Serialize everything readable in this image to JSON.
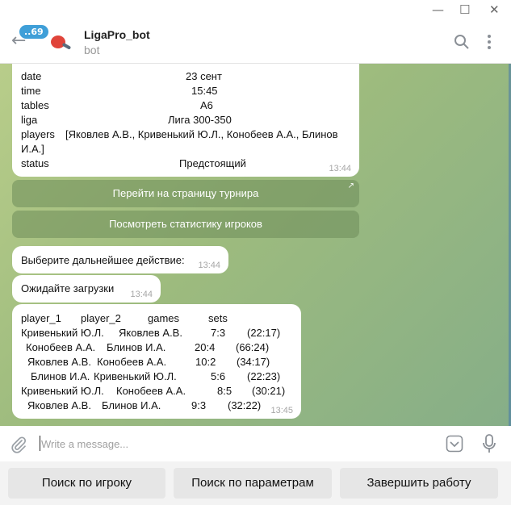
{
  "window": {
    "minimize": "—",
    "maximize": "☐",
    "close": "✕"
  },
  "header": {
    "unread_badge": "..69",
    "title": "LigaPro_bot",
    "subtitle": "bot"
  },
  "messages": {
    "tournament_info": {
      "rows": [
        {
          "key": "date",
          "value": "23 сент"
        },
        {
          "key": "time",
          "value": "15:45"
        },
        {
          "key": "tables",
          "value": "А6"
        },
        {
          "key": "liga",
          "value": "Лига 300-350"
        },
        {
          "key": "players",
          "value": "[Яковлев А.В., Кривенький Ю.Л., Конобеев А.А., Блинов"
        },
        {
          "key": "",
          "value": "И.А.]"
        },
        {
          "key": "status",
          "value": "Предстоящий"
        }
      ],
      "time": "13:44"
    },
    "inline_buttons": [
      {
        "label": "Перейти на страницу турнира"
      },
      {
        "label": "Посмотреть статистику игроков"
      }
    ],
    "choose_action": {
      "text": "Выберите дальнейшее действие:",
      "time": "13:44"
    },
    "loading": {
      "text": "Ожидайте загрузки",
      "time": "13:44"
    },
    "stats": {
      "header": [
        "player_1",
        "player_2",
        "games",
        "sets"
      ],
      "rows": [
        [
          "Кривенький Ю.Л.",
          "Яковлев А.В.",
          "7:3",
          "(22:17)"
        ],
        [
          "Конобеев А.А.",
          "Блинов И.А.",
          "20:4",
          "(66:24)"
        ],
        [
          "Яковлев А.В.",
          "Конобеев А.А.",
          "10:2",
          "(34:17)"
        ],
        [
          "Блинов И.А.",
          "Кривенький Ю.Л.",
          "5:6",
          "(22:23)"
        ],
        [
          "Кривенький Ю.Л.",
          "Конобеев А.А.",
          "8:5",
          "(30:21)"
        ],
        [
          "Яковлев А.В.",
          "Блинов И.А.",
          "9:3",
          "(32:22)"
        ]
      ],
      "time": "13:45"
    }
  },
  "input": {
    "placeholder": "Write a message..."
  },
  "reply_keyboard": [
    {
      "label": "Поиск по игроку"
    },
    {
      "label": "Поиск по параметрам"
    },
    {
      "label": "Завершить работу"
    }
  ],
  "colors": {
    "accent": "#3f9fd8",
    "inline_button_bg": "#6e8c5a",
    "chat_bg": "#9dbb7e"
  },
  "icons": [
    "back-arrow-icon",
    "bot-avatar-icon",
    "search-icon",
    "more-vertical-icon",
    "paperclip-icon",
    "bot-keyboard-icon",
    "microphone-icon",
    "external-link-icon"
  ]
}
